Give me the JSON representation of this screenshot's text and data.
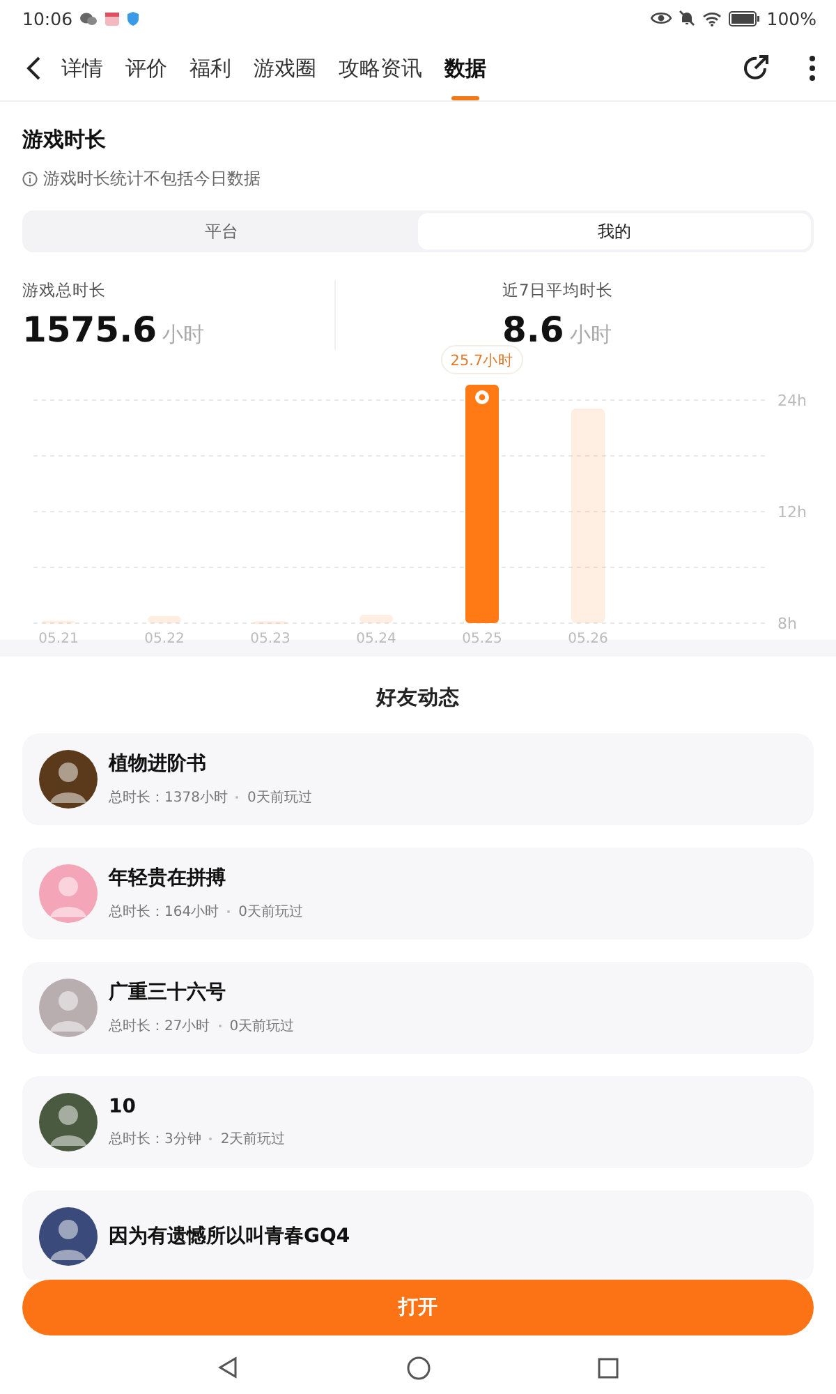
{
  "status_bar": {
    "time": "10:06",
    "battery": "100%"
  },
  "tabs": [
    {
      "label": "详情",
      "selected": false
    },
    {
      "label": "评价",
      "selected": false
    },
    {
      "label": "福利",
      "selected": false
    },
    {
      "label": "游戏圈",
      "selected": false
    },
    {
      "label": "攻略资讯",
      "selected": false
    },
    {
      "label": "数据",
      "selected": true
    }
  ],
  "playtime": {
    "title": "游戏时长",
    "note": "游戏时长统计不包括今日数据",
    "segments": [
      {
        "label": "平台",
        "selected": false
      },
      {
        "label": "我的",
        "selected": true
      }
    ],
    "stats": [
      {
        "label": "游戏总时长",
        "value": "1575.6",
        "unit": "小时"
      },
      {
        "label": "近7日平均时长",
        "value": "8.6",
        "unit": "小时"
      }
    ],
    "chart": {
      "tooltip": "25.7小时",
      "y_axis_labels": [
        "24h",
        "12h",
        "8h"
      ],
      "bars": [
        {
          "label": "05.21",
          "selected": false
        },
        {
          "label": "05.22",
          "selected": false
        },
        {
          "label": "05.23",
          "selected": false
        },
        {
          "label": "05.24",
          "selected": false
        },
        {
          "label": "05.25",
          "selected": true
        },
        {
          "label": "05.26",
          "selected": false
        }
      ]
    }
  },
  "friends": {
    "title": "好友动态",
    "items": [
      {
        "name": "植物进阶书",
        "total": "总时长：1378小时",
        "last": "0天前玩过",
        "color": "#5a3a1a"
      },
      {
        "name": "年轻贵在拼搏",
        "total": "总时长：164小时",
        "last": "0天前玩过",
        "color": "#f4a6b8"
      },
      {
        "name": "广重三十六号",
        "total": "总时长：27小时",
        "last": "0天前玩过",
        "color": "#b8aeb0"
      },
      {
        "name": "10",
        "total": "总时长：3分钟",
        "last": "2天前玩过",
        "color": "#4a5a40"
      },
      {
        "name": "因为有遗憾所以叫青春GQ4",
        "color": "#3a4a7a"
      }
    ]
  },
  "open_button": "打开"
}
